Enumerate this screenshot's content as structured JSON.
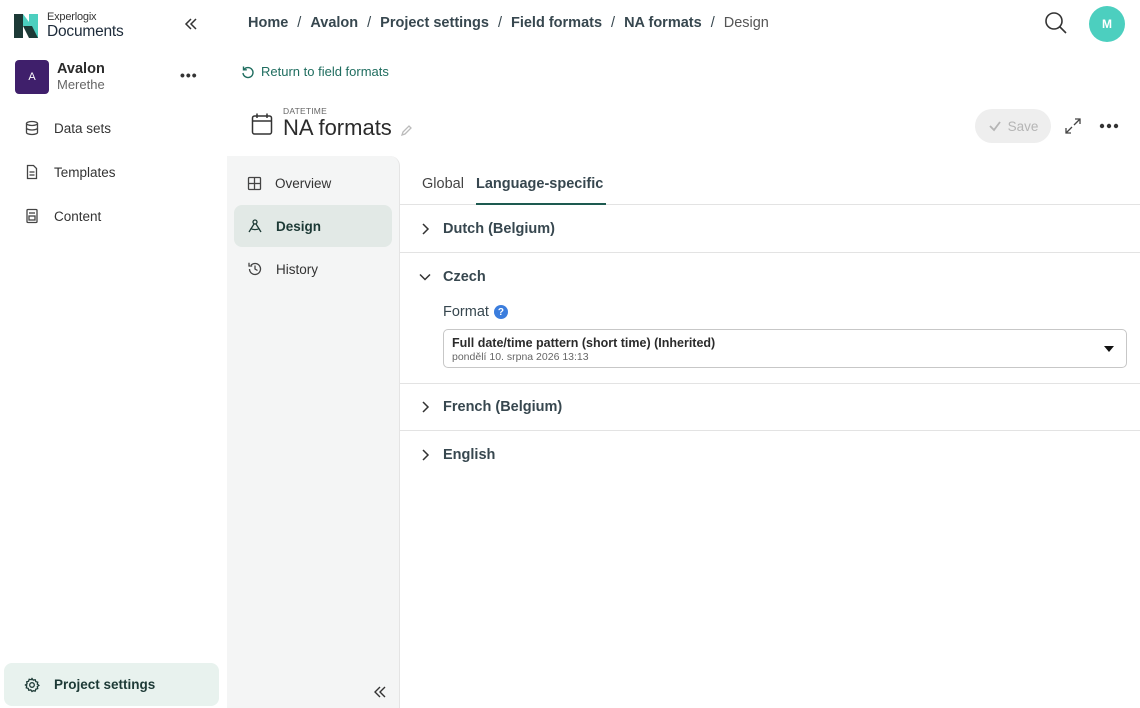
{
  "app": {
    "logo_small": "Experlogix",
    "logo_big": "Documents"
  },
  "workspace": {
    "avatar_letter": "A",
    "name": "Avalon",
    "user": "Merethe",
    "more": "•••"
  },
  "sidebar": {
    "items": [
      {
        "label": "Data sets",
        "icon": "database-icon"
      },
      {
        "label": "Templates",
        "icon": "template-icon"
      },
      {
        "label": "Content",
        "icon": "content-icon"
      }
    ],
    "project_settings": "Project settings"
  },
  "breadcrumb": {
    "items": [
      "Home",
      "Avalon",
      "Project settings",
      "Field formats",
      "NA formats"
    ],
    "current": "Design",
    "separator": "/"
  },
  "user_avatar": "M",
  "return_link": "Return to field formats",
  "header": {
    "type_label": "DATETIME",
    "title": "NA formats"
  },
  "toolbar": {
    "save_label": "Save"
  },
  "inner_nav": {
    "items": [
      {
        "label": "Overview",
        "icon": "grid-icon"
      },
      {
        "label": "Design",
        "icon": "design-icon",
        "active": true
      },
      {
        "label": "History",
        "icon": "history-icon"
      }
    ]
  },
  "tabs": {
    "global": "Global",
    "language_specific": "Language-specific",
    "active": "language_specific"
  },
  "sections": [
    {
      "title": "Dutch (Belgium)",
      "expanded": false
    },
    {
      "title": "Czech",
      "expanded": true,
      "format_label": "Format",
      "format_value": "Full date/time pattern (short time) (Inherited)",
      "format_preview": "pondělí 10. srpna 2026 13:13"
    },
    {
      "title": "French (Belgium)",
      "expanded": false
    },
    {
      "title": "English",
      "expanded": false
    }
  ],
  "colors": {
    "accent": "#1d5a50",
    "workspace_avatar": "#3f1f6b",
    "user_avatar": "#4ccfbf",
    "help": "#3b7ddd",
    "active_bg": "#e8f2ee"
  }
}
